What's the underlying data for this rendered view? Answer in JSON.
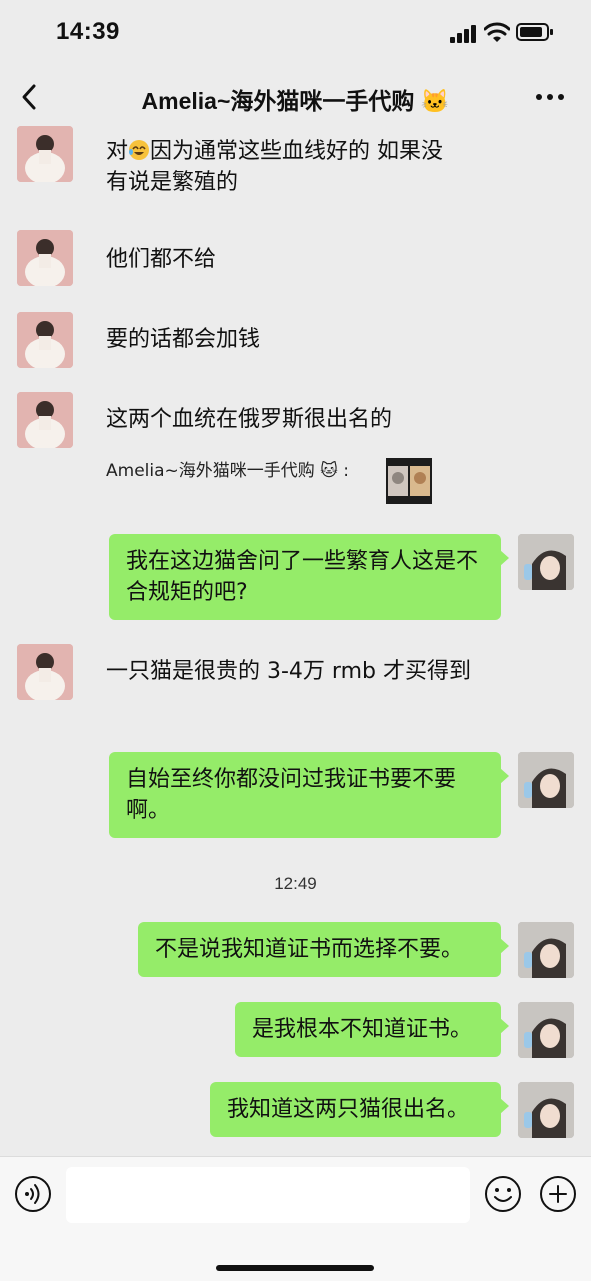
{
  "status_bar": {
    "time": "14:39"
  },
  "header": {
    "title": "Amelia~海外猫咪一手代购 🐱"
  },
  "messages": [
    {
      "line1_pre": "对",
      "line1_post": "因为通常这些血线好的 如果没",
      "line2": "有说是繁殖的"
    },
    {
      "text": "他们都不给"
    },
    {
      "text": "要的话都会加钱"
    },
    {
      "text": "这两个血统在俄罗斯很出名的"
    },
    {
      "text": "我在这边猫舍问了一些繁育人这是不合规矩的吧?"
    },
    {
      "text": "一只猫是很贵的 3-4万 rmb 才买得到"
    },
    {
      "text": "自始至终你都没问过我证书要不要啊。"
    },
    {
      "text": "不是说我知道证书而选择不要。"
    },
    {
      "text": "是我根本不知道证书。"
    },
    {
      "text": "我知道这两只猫很出名。"
    }
  ],
  "quote": {
    "text": "Amelia~海外猫咪一手代购 🐱 :"
  },
  "timestamp": "12:49",
  "input": {
    "placeholder": ""
  },
  "colors": {
    "chat_bg": "#ececec",
    "sent_bubble": "#95ec69",
    "input_bar": "#f7f7f7"
  }
}
